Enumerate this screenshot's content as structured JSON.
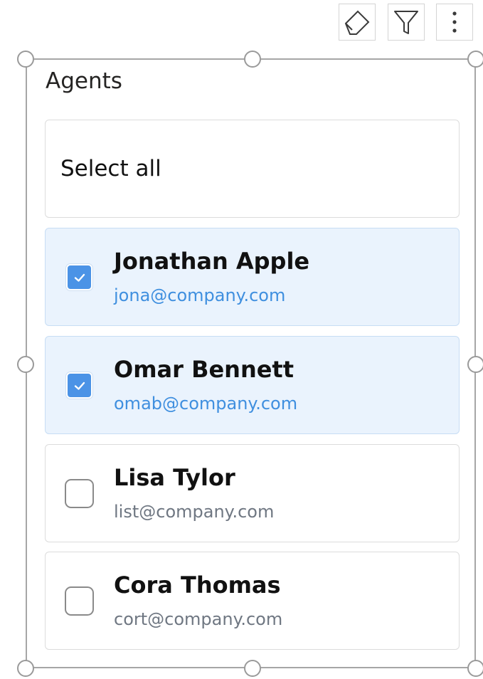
{
  "toolbar": {
    "items": [
      {
        "icon": "eraser-icon"
      },
      {
        "icon": "filter-icon"
      },
      {
        "icon": "more-vertical-icon"
      }
    ]
  },
  "panel": {
    "title": "Agents",
    "select_all_label": "Select all",
    "agents": [
      {
        "name": "Jonathan Apple",
        "email": "jona@company.com",
        "checked": true
      },
      {
        "name": "Omar Bennett",
        "email": "omab@company.com",
        "checked": true
      },
      {
        "name": "Lisa Tylor",
        "email": "list@company.com",
        "checked": false
      },
      {
        "name": "Cora Thomas",
        "email": "cort@company.com",
        "checked": false
      }
    ]
  },
  "colors": {
    "selected_background": "#eaf3fd",
    "checkbox_checked": "#4b93e6",
    "selected_email": "#3f8fdf",
    "frame_border": "#a6a6a6"
  }
}
